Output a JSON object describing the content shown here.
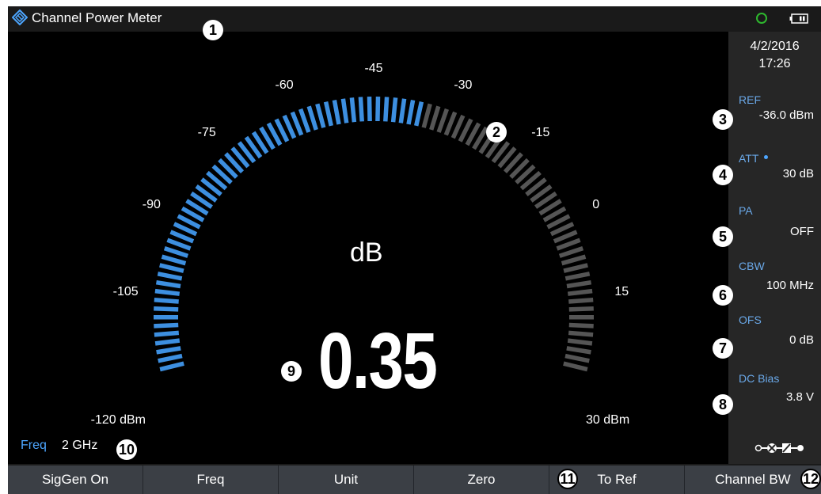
{
  "titlebar": {
    "title": "Channel Power Meter"
  },
  "status": {
    "date": "4/2/2016",
    "time": "17:26"
  },
  "settings": [
    {
      "label": "REF",
      "value": "-36.0 dBm"
    },
    {
      "label": "ATT",
      "value": "30 dB"
    },
    {
      "label": "PA",
      "value": "OFF"
    },
    {
      "label": "CBW",
      "value": "100 MHz"
    },
    {
      "label": "OFS",
      "value": "0 dB"
    },
    {
      "label": "DC Bias",
      "value": "3.8 V"
    }
  ],
  "gauge": {
    "min": -120,
    "max": 30,
    "ref": -36,
    "scale_labels": [
      "-120 dBm",
      "-105",
      "-90",
      "-75",
      "-60",
      "-45",
      "-30",
      "-15",
      "0",
      "15",
      "30 dBm"
    ],
    "unit": "dB",
    "reading": "0.35",
    "colors": {
      "active": "#3d8fe0",
      "inactive": "#555555"
    }
  },
  "footer": {
    "freq_label": "Freq",
    "freq_value": "2 GHz"
  },
  "softkeys": [
    "SigGen On",
    "Freq",
    "Unit",
    "Zero",
    "To Ref",
    "Channel BW"
  ],
  "callouts": [
    "1",
    "2",
    "3",
    "4",
    "5",
    "6",
    "7",
    "8",
    "9",
    "10",
    "11",
    "12"
  ]
}
